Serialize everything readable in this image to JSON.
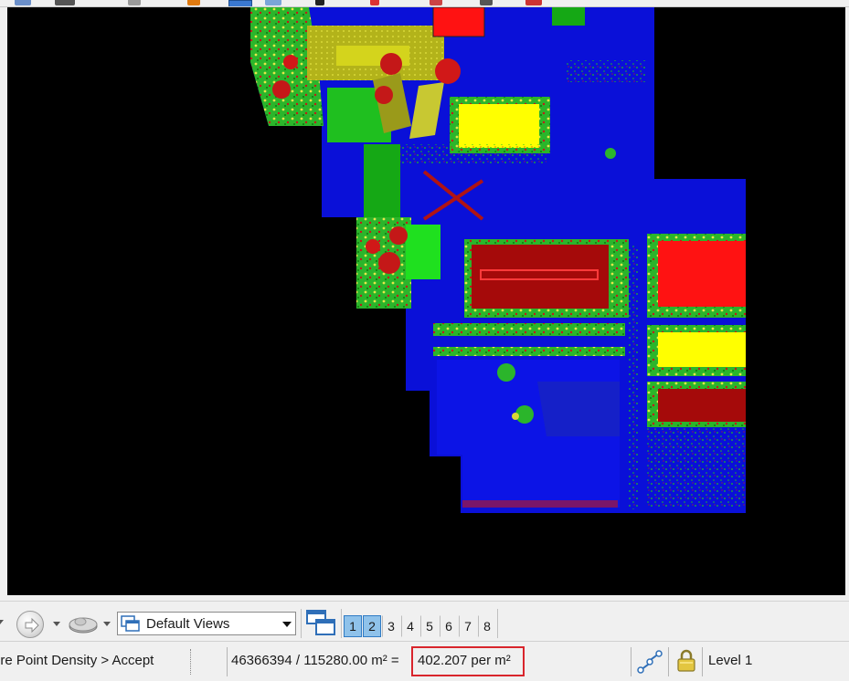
{
  "view_toolbar": {
    "views_dropdown": {
      "selected": "Default Views",
      "icon": "views-icon"
    },
    "view_numbers": [
      "1",
      "2",
      "3",
      "4",
      "5",
      "6",
      "7",
      "8"
    ],
    "active_views": [
      "1",
      "2"
    ]
  },
  "status_bar": {
    "prompt": "ure Point Density > Accept",
    "point_count_area": "46366394 / 115280.00 m² =",
    "density": "402.207 per m²",
    "level": "Level 1"
  },
  "icons": {
    "navigation": "navigate-arrow-icon",
    "disk": "view-disk-icon",
    "multi_window": "multiple-windows-icon",
    "snap": "snap-icon",
    "lock": "lock-icon"
  },
  "colors": {
    "ground": "#0a10d8",
    "low_vegetation": "#1fbf1f",
    "high_vegetation": "#d11818",
    "buildings_red": "#ff1212",
    "buildings_darkred": "#a50a0a",
    "yellow": "#ffff00",
    "highlight_box": "#d9252c",
    "active_view": "#8fc2ea"
  }
}
